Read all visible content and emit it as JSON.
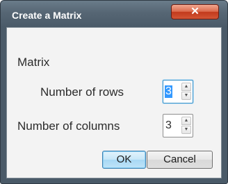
{
  "window": {
    "title": "Create a Matrix",
    "close_icon": "close-icon"
  },
  "section": {
    "heading": "Matrix"
  },
  "rows": {
    "label": "Number of rows",
    "value": "3"
  },
  "columns": {
    "label": "Number of columns",
    "value": "3"
  },
  "buttons": {
    "ok": "OK",
    "cancel": "Cancel"
  },
  "colors": {
    "titlebar": "#566674",
    "close_button": "#d25535",
    "ok_highlight": "#a8d8f4"
  }
}
